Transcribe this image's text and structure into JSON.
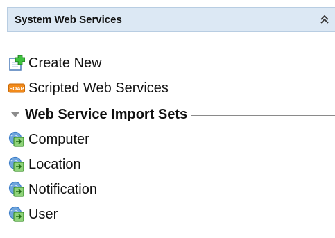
{
  "panel": {
    "title": "System Web Services",
    "collapse_icon": "double-chevron-up-icon"
  },
  "items": {
    "create_new": {
      "label": "Create New",
      "icon": "create-new-icon"
    },
    "scripted": {
      "label": "Scripted Web Services",
      "icon": "soap-icon",
      "icon_text": "SOAP"
    }
  },
  "section": {
    "label": "Web Service Import Sets",
    "icon": "collapse-triangle-icon",
    "items": [
      {
        "label": "Computer",
        "icon": "import-set-icon"
      },
      {
        "label": "Location",
        "icon": "import-set-icon"
      },
      {
        "label": "Notification",
        "icon": "import-set-icon"
      },
      {
        "label": "User",
        "icon": "import-set-icon"
      }
    ]
  },
  "colors": {
    "header_bg": "#dce8f4",
    "header_border": "#b8cde2",
    "soap_orange": "#f28a1a",
    "create_green": "#2fa52f",
    "import_green": "#57b847",
    "import_blue": "#3d7ec9"
  }
}
